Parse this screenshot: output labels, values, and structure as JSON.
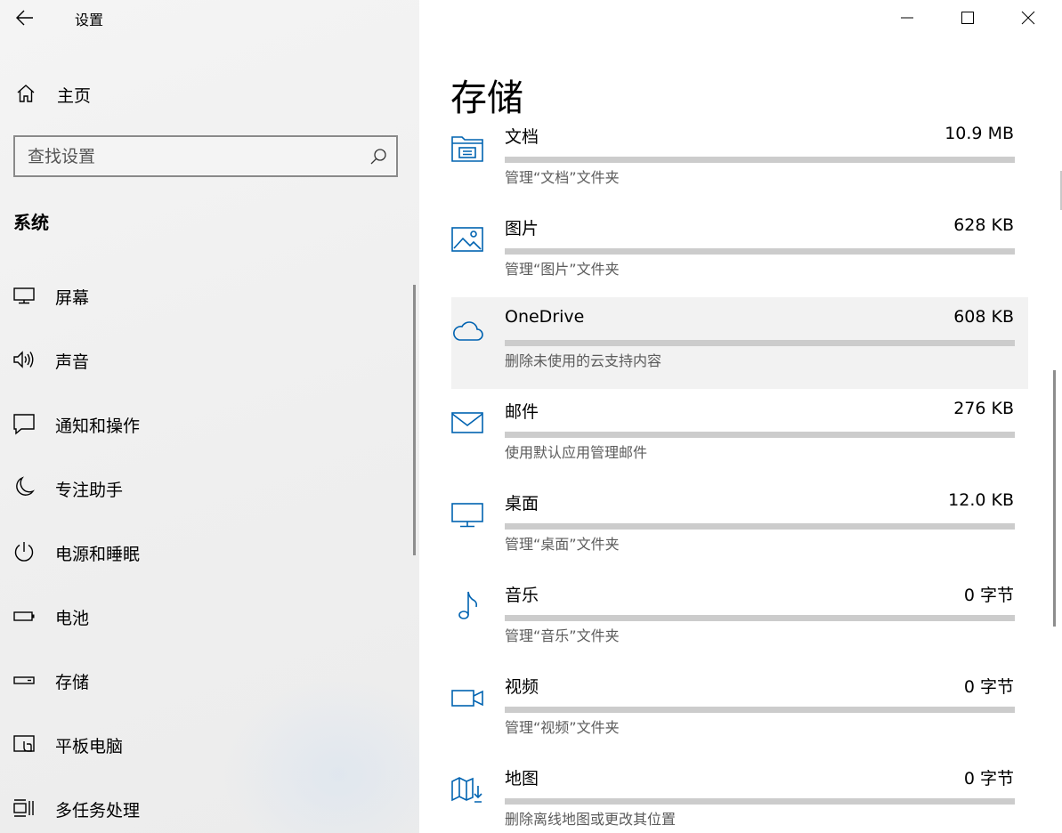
{
  "app": {
    "title": "设置"
  },
  "sidebar": {
    "home_label": "主页",
    "search": {
      "placeholder": "查找设置",
      "value": ""
    },
    "section_title": "系统",
    "items": [
      {
        "label": "屏幕",
        "icon": "monitor-icon"
      },
      {
        "label": "声音",
        "icon": "speaker-icon"
      },
      {
        "label": "通知和操作",
        "icon": "notification-icon"
      },
      {
        "label": "专注助手",
        "icon": "moon-icon"
      },
      {
        "label": "电源和睡眠",
        "icon": "power-icon"
      },
      {
        "label": "电池",
        "icon": "battery-icon"
      },
      {
        "label": "存储",
        "icon": "storage-icon"
      },
      {
        "label": "平板电脑",
        "icon": "tablet-icon"
      },
      {
        "label": "多任务处理",
        "icon": "multitask-icon"
      }
    ]
  },
  "main": {
    "title": "存储",
    "accent_color": "#0063b1",
    "categories": [
      {
        "name": "文档",
        "size": "10.9 MB",
        "desc": "管理“文档”文件夹",
        "icon": "documents-folder-icon",
        "usage": 0
      },
      {
        "name": "图片",
        "size": "628 KB",
        "desc": "管理“图片”文件夹",
        "icon": "pictures-icon",
        "usage": 0
      },
      {
        "name": "OneDrive",
        "size": "608 KB",
        "desc": "删除未使用的云支持内容",
        "icon": "cloud-icon",
        "usage": 0
      },
      {
        "name": "邮件",
        "size": "276 KB",
        "desc": "使用默认应用管理邮件",
        "icon": "mail-icon",
        "usage": 0
      },
      {
        "name": "桌面",
        "size": "12.0 KB",
        "desc": "管理“桌面”文件夹",
        "icon": "desktop-icon",
        "usage": 0
      },
      {
        "name": "音乐",
        "size": "0 字节",
        "desc": "管理“音乐”文件夹",
        "icon": "music-icon",
        "usage": 0
      },
      {
        "name": "视频",
        "size": "0 字节",
        "desc": "管理“视频”文件夹",
        "icon": "video-icon",
        "usage": 0
      },
      {
        "name": "地图",
        "size": "0 字节",
        "desc": "删除离线地图或更改其位置",
        "icon": "map-icon",
        "usage": 0
      }
    ]
  }
}
